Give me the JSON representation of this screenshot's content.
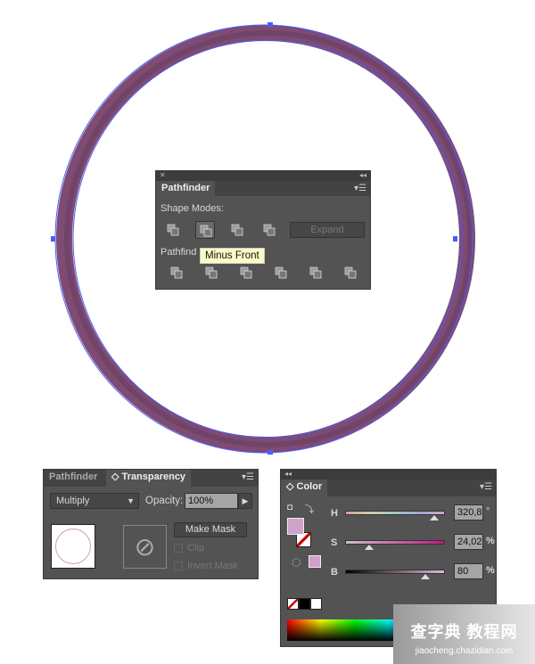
{
  "canvas": {
    "ring_color": "#7e4b72",
    "path_color": "#4a5cff"
  },
  "pathfinder": {
    "tab": "Pathfinder",
    "shape_modes_label": "Shape Modes:",
    "expand_label": "Expand",
    "pathfinders_label": "Pathfind",
    "tooltip": "Minus Front",
    "shape_mode_icons": [
      "unite-icon",
      "minus-front-icon",
      "intersect-icon",
      "exclude-icon"
    ],
    "pathfinder_icons": [
      "divide-icon",
      "trim-icon",
      "merge-icon",
      "crop-icon",
      "outline-icon",
      "minus-back-icon"
    ]
  },
  "transparency": {
    "tabs": [
      "Pathfinder",
      "Transparency"
    ],
    "blend_mode": "Multiply",
    "opacity_label": "Opacity:",
    "opacity": "100%",
    "make_mask": "Make Mask",
    "clip": "Clip",
    "invert_mask": "Invert Mask"
  },
  "color": {
    "tab": "Color",
    "fill": "#d0a2c8",
    "h_label": "H",
    "h": "320,8",
    "h_unit": "°",
    "s_label": "S",
    "s": "24,02",
    "s_unit": "%",
    "b_label": "B",
    "b": "80",
    "b_unit": "%",
    "h_value": 320.8,
    "s_value": 24.02,
    "b_value": 80
  },
  "watermark": {
    "logo": "查字典 教程网",
    "url": "jiaocheng.chazidian.com"
  }
}
